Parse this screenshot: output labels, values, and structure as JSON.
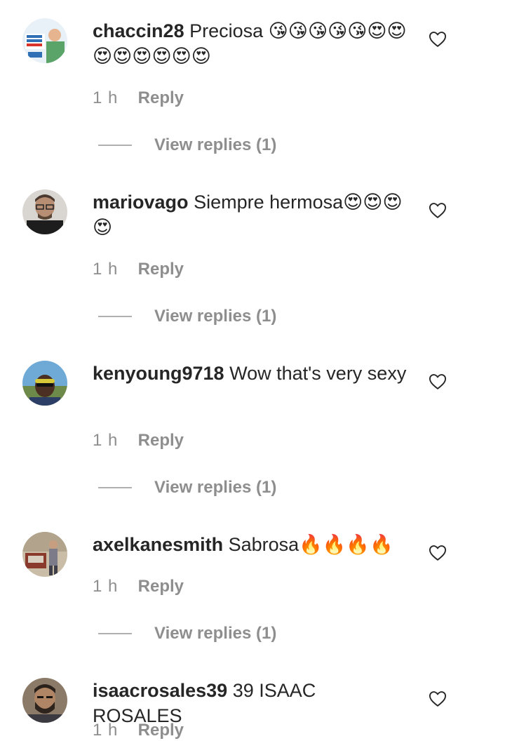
{
  "comments": [
    {
      "username": "chaccin28",
      "text": "Preciosa 😘😘😘😘😘😍😍😍😍😍😍😍😍",
      "time": "1 h",
      "reply_label": "Reply",
      "view_replies": "View replies (1)",
      "avatar_icon": "campaign-poster-avatar",
      "avatar_color": "#2f6fb5"
    },
    {
      "username": "mariovago",
      "text": "Siempre hermosa😍😍😍😍",
      "time": "1 h",
      "reply_label": "Reply",
      "view_replies": "View replies (1)",
      "avatar_icon": "man-with-glasses-avatar",
      "avatar_color": "#6b5a4e"
    },
    {
      "username": "kenyoung9718",
      "text": "Wow that's very sexy",
      "time": "1 h",
      "reply_label": "Reply",
      "view_replies": "View replies (1)",
      "avatar_icon": "man-in-sunglasses-outdoors-avatar",
      "avatar_color": "#4a8fc4"
    },
    {
      "username": "axelkanesmith",
      "text": "Sabrosa🔥🔥🔥🔥",
      "time": "1 h",
      "reply_label": "Reply",
      "view_replies": "View replies (1)",
      "avatar_icon": "vintage-photo-avatar",
      "avatar_color": "#9a8a74"
    },
    {
      "username": "isaacrosales39",
      "text": "39 ISAAC ROSALES",
      "time": "1 h",
      "reply_label": "Reply",
      "avatar_icon": "bearded-man-avatar",
      "avatar_color": "#4b3f36"
    }
  ],
  "colors": {
    "text_primary": "#262626",
    "text_secondary": "#8e8e8e",
    "divider": "#b0b0b0",
    "background": "#ffffff"
  },
  "icons": {
    "like": "heart-outline-icon"
  }
}
